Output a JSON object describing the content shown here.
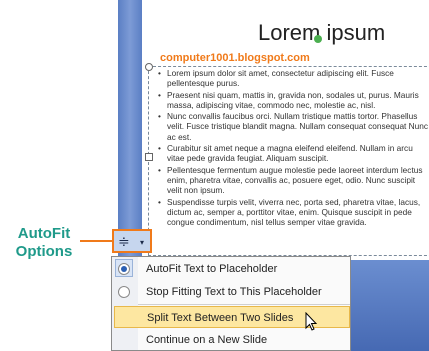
{
  "slide": {
    "title": "Lorem ipsum",
    "watermark": "computer1001.blogspot.com",
    "bullets": [
      "Lorem ipsum dolor sit amet, consectetur adipiscing elit. Fusce pellentesque purus.",
      "Praesent nisi quam, mattis in, gravida non, sodales ut, purus. Mauris massa, adipiscing vitae, commodo nec, molestie ac, nisl.",
      "Nunc convallis faucibus orci. Nullam tristique mattis tortor. Phasellus velit. Fusce tristique blandit magna. Nullam consequat consequat Nunc ac est.",
      "Curabitur sit amet neque a magna eleifend eleifend. Nullam in arcu vitae pede gravida feugiat. Aliquam suscipit.",
      "Pellentesque fermentum augue molestie pede laoreet interdum lectus enim, pharetra vitae, convallis ac, posuere eget, odio. Nunc suscipit velit non ipsum.",
      "Suspendisse turpis velit, viverra nec, porta sed, pharetra vitae, lacus, dictum ac, semper a, porttitor vitae, enim. Quisque suscipit in pede congue condimentum, nisl tellus semper vitae gravida."
    ]
  },
  "callout": {
    "line1": "AutoFit",
    "line2": "Options"
  },
  "autofit_button": {
    "icon": "autofit-icon",
    "caret": "▾"
  },
  "menu": {
    "items": [
      {
        "label": "AutoFit Text to Placeholder",
        "type": "radio",
        "checked": true
      },
      {
        "label": "Stop Fitting Text to This Placeholder",
        "type": "radio",
        "checked": false
      },
      {
        "label": "Split Text Between Two Slides",
        "type": "action",
        "hover": true
      },
      {
        "label": "Continue on a New Slide",
        "type": "action"
      }
    ]
  },
  "colors": {
    "accent": "#f07a1a",
    "callout_text": "#1f9a8a",
    "hover": "#fde7a1"
  }
}
